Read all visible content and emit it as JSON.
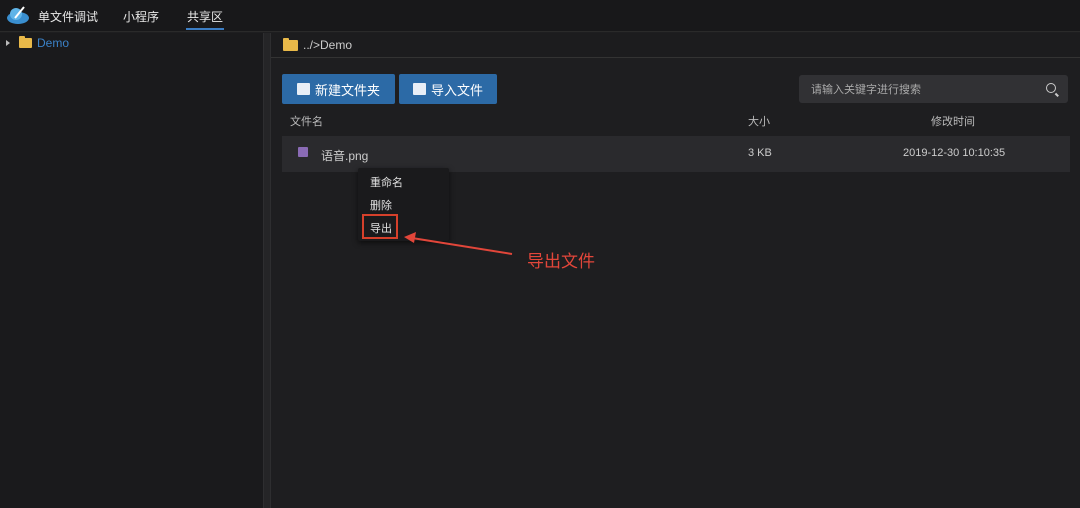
{
  "topbar": {
    "tabs": [
      {
        "label": "单文件调试"
      },
      {
        "label": "小程序"
      },
      {
        "label": "共享区",
        "active": true
      }
    ]
  },
  "sidebar": {
    "tree": [
      {
        "label": "Demo",
        "icon": "folder-icon"
      }
    ]
  },
  "pathbar": {
    "path": "../>Demo"
  },
  "toolbar": {
    "new_folder": "新建文件夹",
    "import_file": "导入文件",
    "search_placeholder": "请输入关键字进行搜索"
  },
  "table": {
    "headers": [
      "文件名",
      "大小",
      "修改时间"
    ],
    "rows": [
      {
        "name": "语音.png",
        "size": "3 KB",
        "modified": "2019-12-30 10:10:35"
      }
    ]
  },
  "context_menu": {
    "items": [
      "重命名",
      "删除",
      "导出"
    ]
  },
  "annotation": {
    "text": "导出文件",
    "color": "#e2463a"
  },
  "colors": {
    "accent": "#2c6aa6",
    "link": "#3b82c8"
  }
}
